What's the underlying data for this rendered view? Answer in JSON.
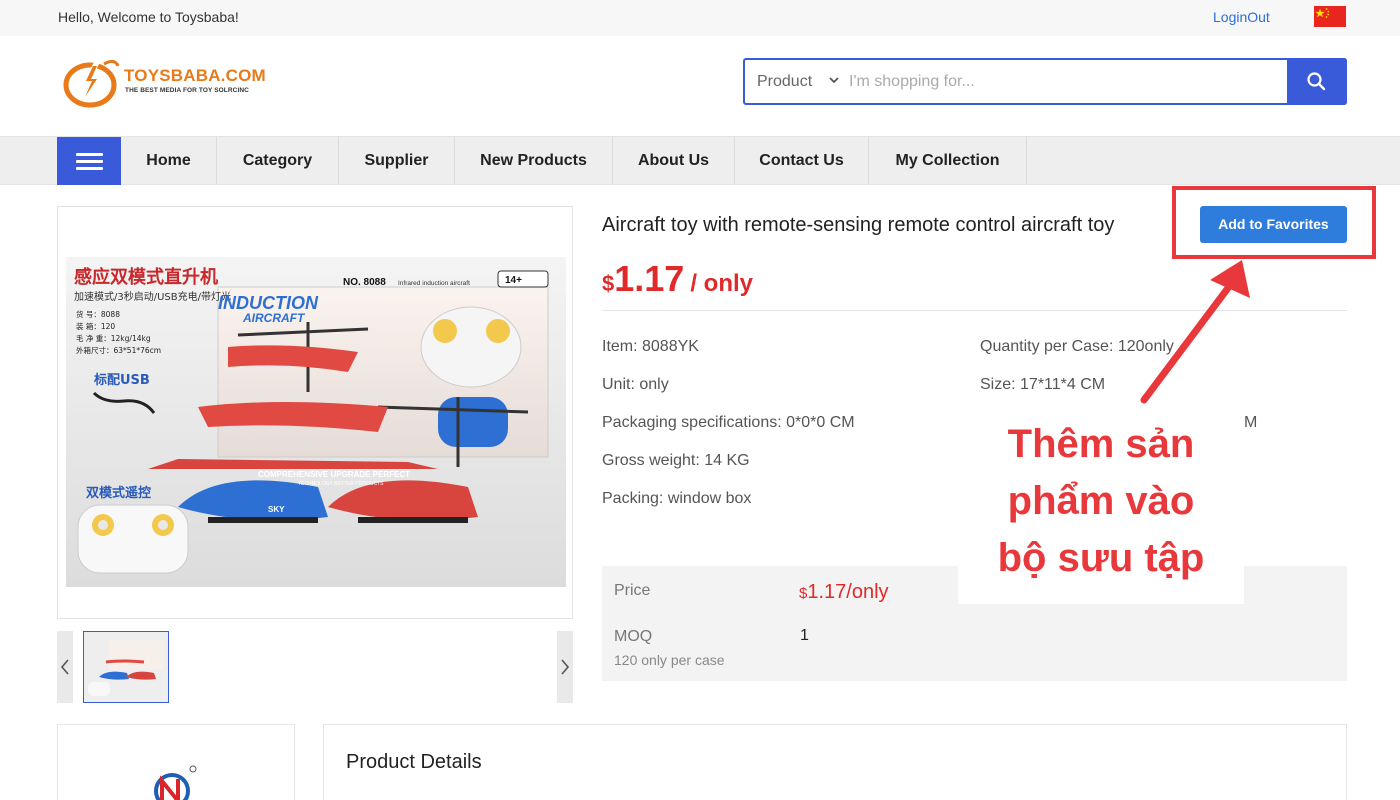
{
  "topbar": {
    "welcome": "Hello, Welcome to Toysbaba!",
    "logout": "LoginOut",
    "flag_icon": "china-flag-icon"
  },
  "header": {
    "logo": {
      "brand": "TOYSBABA.COM",
      "tagline": "THE BEST MEDIA FOR TOY SOLRCINC",
      "accent": "#e97a19"
    },
    "search": {
      "category": "Product",
      "placeholder": "I'm shopping for...",
      "button_icon": "search-icon",
      "accent": "#3a5bd9"
    }
  },
  "nav": {
    "menu_icon": "hamburger-menu-icon",
    "items": [
      "Home",
      "Category",
      "Supplier",
      "New Products",
      "About Us",
      "Contact Us",
      "My Collection"
    ]
  },
  "product": {
    "title": "Aircraft toy with remote-sensing remote control aircraft toy",
    "favorite_button": "Add to Favorites",
    "price": {
      "currency": "$",
      "amount": "1.17",
      "unit": "/ only",
      "color": "#e02a2a"
    },
    "specs": {
      "item": "Item: 8088YK",
      "qty_case": "Quantity per Case: 120only",
      "unit": "Unit: only",
      "size": "Size: 17*11*4 CM",
      "packaging": "Packaging specifications: 0*0*0 CM",
      "partial": "M",
      "gross_weight": "Gross weight: 14 KG",
      "packing": "Packing: window box"
    },
    "price_table": {
      "price_label": "Price",
      "price_currency": "$",
      "price_value": "1.17/only",
      "moq_label": "MOQ",
      "moq_sub": "120 only per case",
      "moq_value": "1"
    }
  },
  "annotation": {
    "lines": [
      "Thêm sản",
      "phẩm vào",
      "bộ sưu tập"
    ],
    "color": "#e8383b"
  },
  "image_text": {
    "cn_title": "感应双模式直升机",
    "cn_subtitle": "加速模式/3秒启动/USB充电/带灯光",
    "model": "NO. 8088",
    "infrared": "Infrared induction aircraft",
    "age": "14+",
    "induction": "INDUCTION",
    "aircraft": "AIRCRAFT",
    "spec1": "货    号：8088",
    "spec2": "装    箱：120",
    "spec3": "毛 净 重：12kg/14kg",
    "spec4": "外箱尺寸：63*51*76cm",
    "usb": "标配USB",
    "dual": "双模式遥控",
    "banner": "COMPREHENSIVE UPGRADE PERFECT",
    "banner2": "TECHNOLOGY BETTER PRODUCTS",
    "sky": "SKY"
  },
  "bottom": {
    "product_details": "Product Details"
  }
}
